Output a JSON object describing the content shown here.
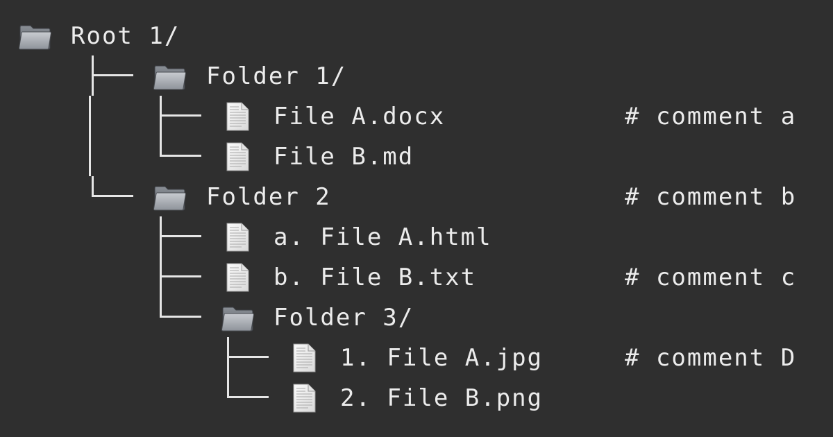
{
  "tree": {
    "root": {
      "label": "Root 1/",
      "icon": "folder-icon"
    },
    "folder1": {
      "label": "Folder 1/",
      "icon": "folder-icon"
    },
    "file_a_docx": {
      "label": "File A.docx",
      "icon": "file-icon",
      "comment": "# comment a"
    },
    "file_b_md": {
      "label": "File B.md",
      "icon": "file-icon"
    },
    "folder2": {
      "label": "Folder 2",
      "icon": "folder-icon",
      "comment": "# comment b"
    },
    "file_a_html": {
      "label": "a. File A.html",
      "icon": "file-icon"
    },
    "file_b_txt": {
      "label": "b. File B.txt",
      "icon": "file-icon",
      "comment": "# comment c"
    },
    "folder3": {
      "label": "Folder 3/",
      "icon": "folder-icon"
    },
    "file_a_jpg": {
      "label": "1. File A.jpg",
      "icon": "file-icon",
      "comment": "# comment D"
    },
    "file_b_png": {
      "label": "2. File B.png",
      "icon": "file-icon"
    }
  },
  "colors": {
    "background": "#2f2f2f",
    "text": "#ececec",
    "lines": "#e6e6e6"
  }
}
